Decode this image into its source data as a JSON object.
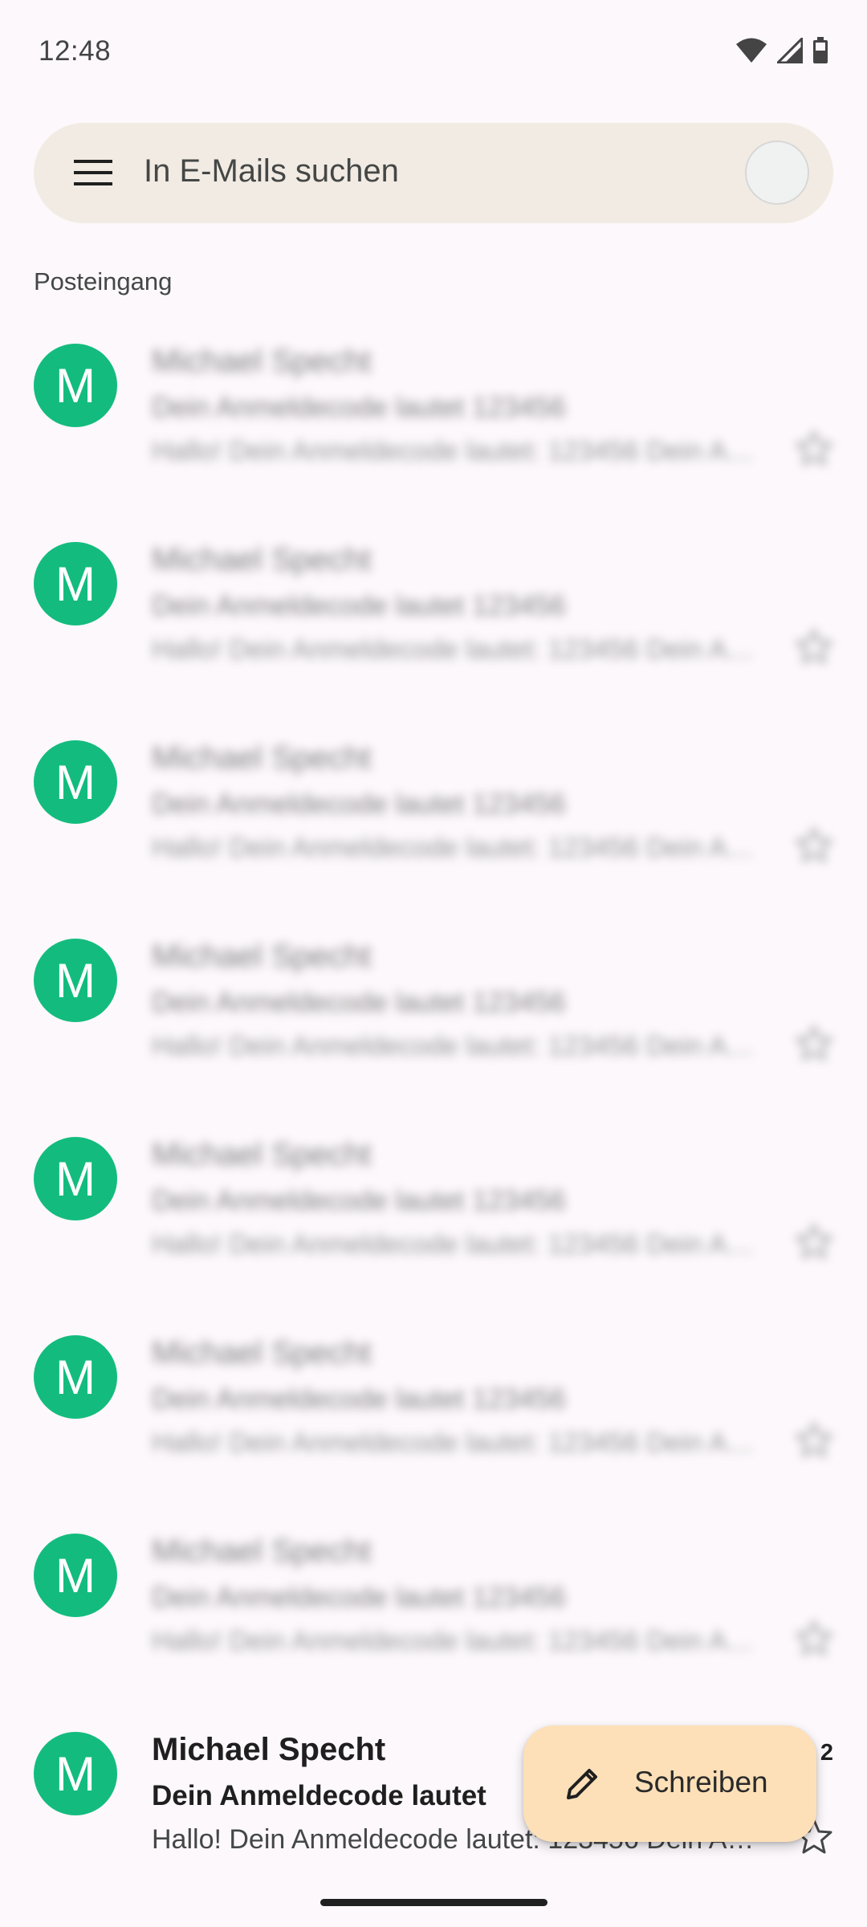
{
  "status_bar": {
    "time": "12:48",
    "icons": [
      "wifi-icon",
      "cell-signal-icon",
      "battery-icon"
    ]
  },
  "search": {
    "placeholder": "In E-Mails suchen"
  },
  "section": {
    "label": "Posteingang"
  },
  "mails": [
    {
      "initial": "M",
      "sender": "Michael Specht",
      "date": "",
      "subject": "Dein Anmeldecode lautet 123456",
      "preview": "Hallo! Dein Anmeldecode lautet: 123456 Dein Anmeldecode",
      "blurred": true
    },
    {
      "initial": "M",
      "sender": "Michael Specht",
      "date": "",
      "subject": "Dein Anmeldecode lautet 123456",
      "preview": "Hallo! Dein Anmeldecode lautet: 123456 Dein Anmeldecode",
      "blurred": true
    },
    {
      "initial": "M",
      "sender": "Michael Specht",
      "date": "",
      "subject": "Dein Anmeldecode lautet 123456",
      "preview": "Hallo! Dein Anmeldecode lautet: 123456 Dein Anmeldecode",
      "blurred": true
    },
    {
      "initial": "M",
      "sender": "Michael Specht",
      "date": "",
      "subject": "Dein Anmeldecode lautet 123456",
      "preview": "Hallo! Dein Anmeldecode lautet: 123456 Dein Anmeldecode",
      "blurred": true
    },
    {
      "initial": "M",
      "sender": "Michael Specht",
      "date": "",
      "subject": "Dein Anmeldecode lautet 123456",
      "preview": "Hallo! Dein Anmeldecode lautet: 123456 Dein Anmeldecode",
      "blurred": true
    },
    {
      "initial": "M",
      "sender": "Michael Specht",
      "date": "",
      "subject": "Dein Anmeldecode lautet 123456",
      "preview": "Hallo! Dein Anmeldecode lautet: 123456 Dein Anmeldecode",
      "blurred": true
    },
    {
      "initial": "M",
      "sender": "Michael Specht",
      "date": "",
      "subject": "Dein Anmeldecode lautet 123456",
      "preview": "Hallo! Dein Anmeldecode lautet: 123456 Dein Anmeldecode",
      "blurred": true
    },
    {
      "initial": "M",
      "sender": "Michael Specht",
      "date": "2",
      "subject": "Dein Anmeldecode lautet",
      "preview": "Hallo! Dein Anmeldecode lautet: 123456 Dein Anmeldecode",
      "blurred": false
    }
  ],
  "compose": {
    "label": "Schreiben"
  },
  "colors": {
    "avatar": "#13bc7e",
    "search_bg": "#f2ebe3",
    "fab_bg": "#fde0b8",
    "page_bg": "#fcf8fb"
  }
}
